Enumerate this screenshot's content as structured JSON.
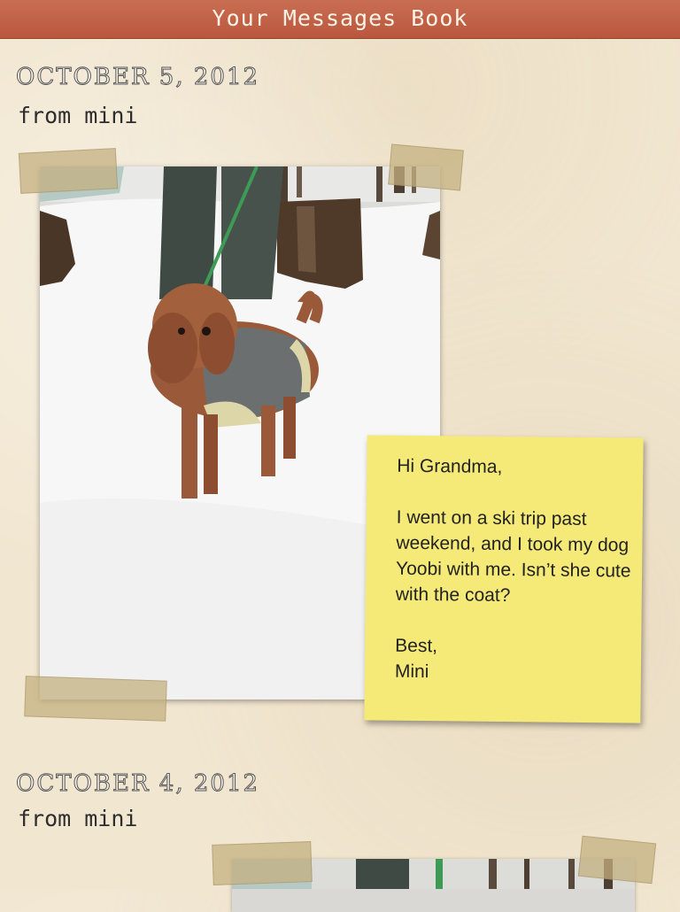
{
  "header": {
    "title": "Your Messages Book"
  },
  "messages": [
    {
      "date": "OCTOBER 5, 2012",
      "from": "from mini",
      "note": {
        "greeting": "Hi Grandma,",
        "body": "I went on a ski trip past weekend, and I took my dog Yoobi with me. Isn’t she cute with the coat?",
        "closing": "Best,",
        "signature": "Mini"
      }
    },
    {
      "date": "OCTOBER 4, 2012",
      "from": "from mini"
    }
  ],
  "colors": {
    "header_bar": "#bd5d42",
    "paper": "#f1e6d0",
    "sticky_note": "#f5ea77"
  }
}
